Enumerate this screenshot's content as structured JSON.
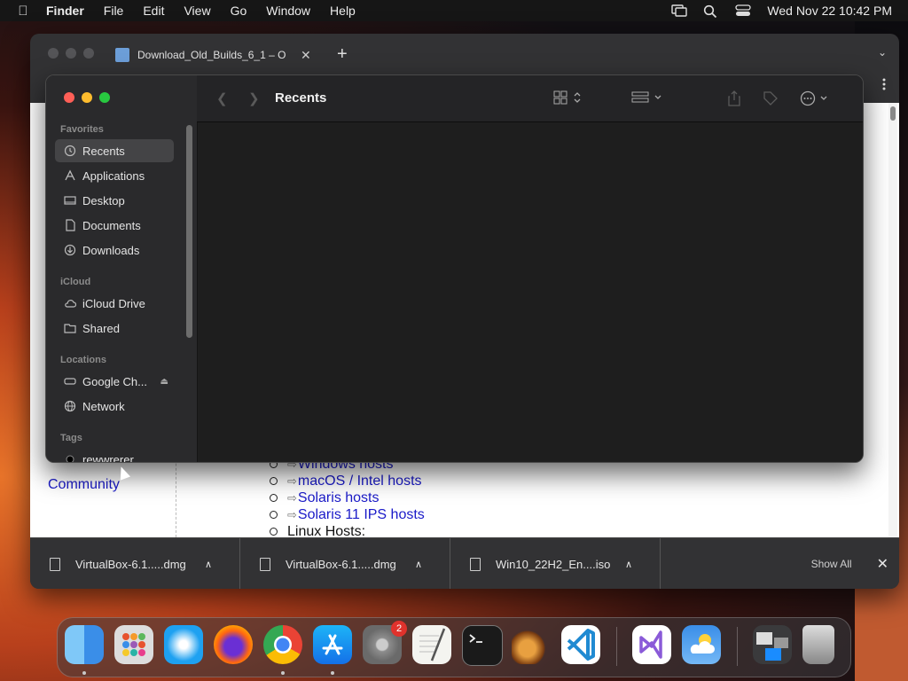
{
  "menubar": {
    "items": [
      "Finder",
      "File",
      "Edit",
      "View",
      "Go",
      "Window",
      "Help"
    ],
    "clock": "Wed Nov 22  10:42 PM"
  },
  "browser": {
    "tab_title": "Download_Old_Builds_6_1 – O",
    "page": {
      "community": "Community",
      "hosts": [
        {
          "text": "Windows hosts",
          "link": true
        },
        {
          "text": "macOS / Intel hosts",
          "link": true
        },
        {
          "text": "Solaris hosts",
          "link": true
        },
        {
          "text": "Solaris 11 IPS hosts",
          "link": true
        },
        {
          "text": "Linux Hosts:",
          "link": false
        }
      ]
    },
    "downloads": [
      {
        "name": "VirtualBox-6.1.....dmg"
      },
      {
        "name": "VirtualBox-6.1.....dmg"
      },
      {
        "name": "Win10_22H2_En....iso"
      }
    ],
    "show_all": "Show All"
  },
  "finder": {
    "title": "Recents",
    "sidebar": {
      "favorites_header": "Favorites",
      "favorites": [
        "Recents",
        "Applications",
        "Desktop",
        "Documents",
        "Downloads"
      ],
      "icloud_header": "iCloud",
      "icloud": [
        "iCloud Drive",
        "Shared"
      ],
      "locations_header": "Locations",
      "locations": [
        "Google Ch...",
        "Network"
      ],
      "tags_header": "Tags",
      "tags": [
        "rewwrerer"
      ]
    }
  },
  "dock": {
    "apps": [
      "finder",
      "launchpad",
      "safari",
      "firefox",
      "chrome",
      "app-store",
      "system-settings",
      "textedit",
      "terminal",
      "garageband",
      "vscode",
      "visual-studio",
      "weather",
      "downloads-stack",
      "trash"
    ],
    "badge_count": "2"
  },
  "colors": {
    "link": "#1a1ac8",
    "finder_bg": "#1e1e1e",
    "sidebar_bg": "#2a2a2c",
    "close": "#ff5f57",
    "minimize": "#febc2e",
    "zoom": "#28c840"
  }
}
